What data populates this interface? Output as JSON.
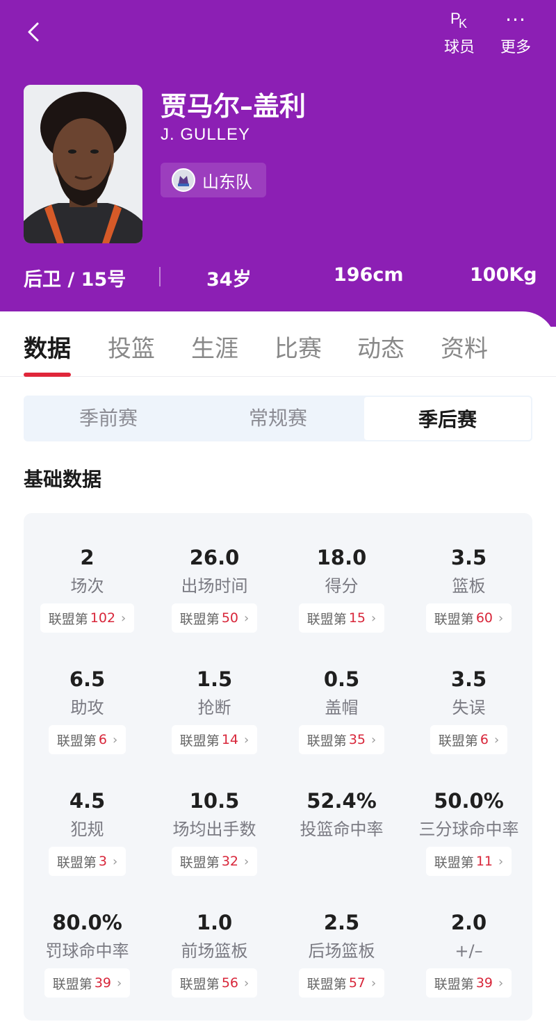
{
  "header": {
    "actions": [
      {
        "label": "球员",
        "icon": "pk-icon"
      },
      {
        "label": "更多",
        "icon": "more-icon"
      }
    ],
    "pk_glyph": {
      "p": "P",
      "k": "K"
    },
    "more_glyph": "···",
    "player": {
      "name_cn": "贾马尔–盖利",
      "name_en": "J. GULLEY",
      "team": "山东队",
      "position_number": "后卫 / 15号",
      "age": "34岁",
      "height": "196cm",
      "weight": "100Kg"
    }
  },
  "tabs": [
    "数据",
    "投篮",
    "生涯",
    "比赛",
    "动态",
    "资料"
  ],
  "active_tab": 0,
  "season_segments": [
    "季前赛",
    "常规赛",
    "季后赛"
  ],
  "active_segment": 2,
  "section_title": "基础数据",
  "rank_prefix": "联盟第",
  "stats": [
    {
      "value": "2",
      "label": "场次",
      "rank": "102"
    },
    {
      "value": "26.0",
      "label": "出场时间",
      "rank": "50"
    },
    {
      "value": "18.0",
      "label": "得分",
      "rank": "15"
    },
    {
      "value": "3.5",
      "label": "篮板",
      "rank": "60"
    },
    {
      "value": "6.5",
      "label": "助攻",
      "rank": "6"
    },
    {
      "value": "1.5",
      "label": "抢断",
      "rank": "14"
    },
    {
      "value": "0.5",
      "label": "盖帽",
      "rank": "35"
    },
    {
      "value": "3.5",
      "label": "失误",
      "rank": "6"
    },
    {
      "value": "4.5",
      "label": "犯规",
      "rank": "3"
    },
    {
      "value": "10.5",
      "label": "场均出手数",
      "rank": "32"
    },
    {
      "value": "52.4%",
      "label": "投篮命中率",
      "rank": null
    },
    {
      "value": "50.0%",
      "label": "三分球命中率",
      "rank": "11"
    },
    {
      "value": "80.0%",
      "label": "罚球命中率",
      "rank": "39"
    },
    {
      "value": "1.0",
      "label": "前场篮板",
      "rank": "56"
    },
    {
      "value": "2.5",
      "label": "后场篮板",
      "rank": "57"
    },
    {
      "value": "2.0",
      "label": "+/–",
      "rank": "39"
    }
  ],
  "colors": {
    "header_bg": "#8c1fb4",
    "accent_red": "#e0263a",
    "rank_red": "#d8263a"
  }
}
